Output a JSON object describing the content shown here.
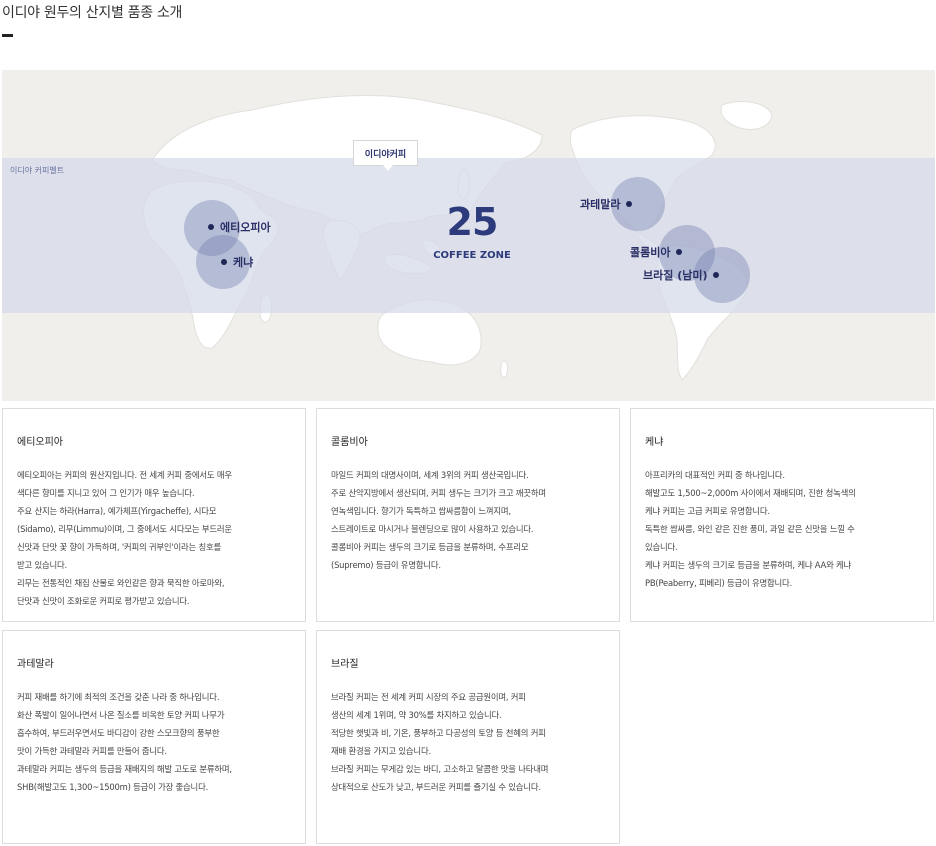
{
  "header": {
    "title": "이디야 원두의 산지별 품종 소개"
  },
  "map": {
    "belt_label": "이디야 커피벨트",
    "brand_tag": "이디야커피",
    "zone_number": "25",
    "zone_label": "COFFEE ZONE",
    "origins": {
      "ethiopia": "에티오피아",
      "kenya": "케냐",
      "guatemala": "과테말라",
      "colombia": "콜롬비아",
      "brazil": "브라질 (남미)"
    }
  },
  "cards": {
    "ethiopia": {
      "title": "에티오피아",
      "lines": [
        "에티오피아는 커피의 원산지입니다. 전 세계 커피 중에서도 매우",
        "색다른 향미를 지니고 있어 그 인기가 매우 높습니다.",
        "주요 산지는 하라(Harra), 예가체프(Yirgacheffe), 시다모",
        "(Sidamo), 리무(Limmu)이며, 그 중에서도 시다모는 부드러운",
        "신맛과 단맛 꽃 향이 가득하며, '커피의 귀부인'이라는 칭호를",
        "받고 있습니다.",
        "리무는 전통적인 채집 산물로 와인같은 향과 묵직한 아로마와,",
        "단맛과 신맛이 조화로운 커피로 평가받고 있습니다."
      ]
    },
    "colombia": {
      "title": "콜롬비아",
      "lines": [
        "마일드 커피의 대명사이며, 세계 3위의 커피 생산국입니다.",
        "주로 산악지방에서 생산되며, 커피 생두는 크기가 크고 깨끗하며",
        "연녹색입니다. 향기가 독특하고 쌉싸름함이 느껴지며,",
        "스트레이트로 마시거나 블렌딩으로 많이 사용하고 있습니다.",
        "콜롬비아 커피는 생두의 크기로 등급을 분류하며, 수프리모",
        "(Supremo) 등급이 유명합니다."
      ]
    },
    "kenya": {
      "title": "케냐",
      "lines": [
        "아프리카의 대표적인 커피 중 하나입니다.",
        "해발고도 1,500~2,000m 사이에서 재배되며, 진한 청녹색의",
        "케냐 커피는 고급 커피로 유명합니다.",
        "독특한 쌉싸름, 와인 같은 진한 풍미, 과일 같은 신맛을 느낄 수",
        "있습니다.",
        "케냐 커피는 생두의 크기로 등급을 분류하며, 케냐 AA와 케냐",
        "PB(Peaberry, 피베리) 등급이 유명합니다."
      ]
    },
    "guatemala": {
      "title": "과테말라",
      "lines": [
        "커피 재배를 하기에 최적의 조건을 갖춘 나라 중 하나입니다.",
        "화산 폭발이 일어나면서 나온 질소를 비옥한 토양 커피 나무가",
        "흡수하여, 부드러우면서도 바디감이 강한 스모크향의 풍부한",
        "맛이 가득한 과테말라 커피를 만들어 줍니다.",
        "과테말라 커피는 생두의 등급을 재배지의 해발 고도로 분류하며,",
        "SHB(해발고도 1,300~1500m) 등급이 가장 좋습니다."
      ]
    },
    "brazil": {
      "title": "브라질",
      "lines": [
        "브라질 커피는 전 세계 커피 시장의 주요 공급원이며, 커피",
        "생산의 세계 1위며, 약 30%를 차지하고 있습니다.",
        "적당한 햇빛과 비, 기온, 풍부하고 다공성의 토양 등 천혜의 커피",
        "재배 환경을 가지고 있습니다.",
        "브라질 커피는 무게감 있는 바디, 고소하고 달콤한 맛을 나타내며",
        "상대적으로 산도가 낮고, 부드러운 커피를 즐기실 수 있습니다."
      ]
    }
  }
}
